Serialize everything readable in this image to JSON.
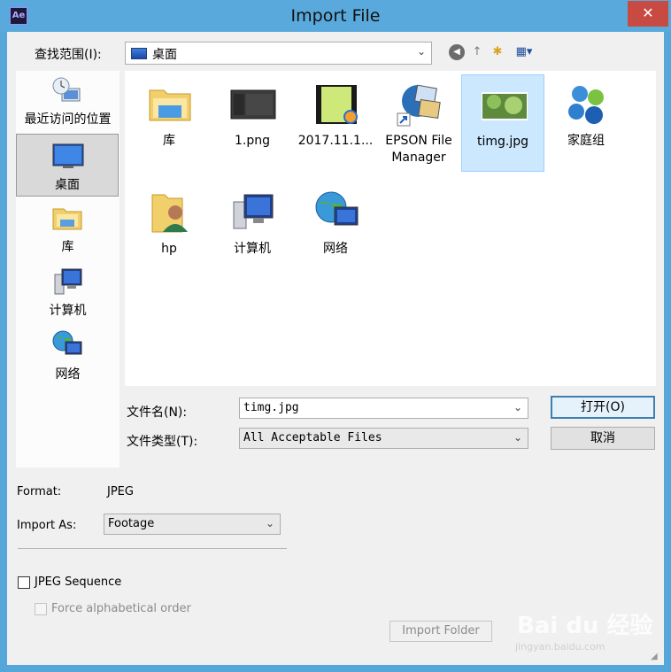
{
  "window": {
    "title": "Import File",
    "app_icon": "Ae",
    "close_glyph": "✕"
  },
  "toolbar": {
    "lookin_label": "查找范围(I):",
    "lookin_value": "桌面",
    "back_icon": "◀",
    "up_icon": "↑",
    "newfolder_icon": "✱",
    "views_icon": "▦▾"
  },
  "places": [
    {
      "label": "最近访问的位置",
      "icon": "recent-places-icon"
    },
    {
      "label": "桌面",
      "icon": "desktop-icon",
      "selected": true
    },
    {
      "label": "库",
      "icon": "library-icon"
    },
    {
      "label": "计算机",
      "icon": "computer-icon"
    },
    {
      "label": "网络",
      "icon": "network-icon"
    }
  ],
  "files": [
    {
      "label": "库",
      "icon": "library-folder-icon"
    },
    {
      "label": "1.png",
      "icon": "png-thumbnail-icon"
    },
    {
      "label": "2017.11.1...",
      "icon": "video-file-icon"
    },
    {
      "label": "EPSON File Manager",
      "icon": "epson-shortcut-icon"
    },
    {
      "label": "timg.jpg",
      "icon": "jpg-thumbnail-icon",
      "selected": true
    },
    {
      "label": "家庭组",
      "icon": "homegroup-icon"
    },
    {
      "label": "hp",
      "icon": "user-folder-icon"
    },
    {
      "label": "计算机",
      "icon": "computer-icon"
    },
    {
      "label": "网络",
      "icon": "network-icon"
    }
  ],
  "form": {
    "filename_label": "文件名(N):",
    "filename_value": "timg.jpg",
    "filetype_label": "文件类型(T):",
    "filetype_value": "All Acceptable Files",
    "open_label": "打开(O)",
    "cancel_label": "取消"
  },
  "options": {
    "format_label": "Format:",
    "format_value": "JPEG",
    "import_as_label": "Import As:",
    "import_as_value": "Footage",
    "sequence_label": "JPEG Sequence",
    "alpha_label": "Force alphabetical order",
    "import_folder_label": "Import Folder"
  },
  "watermark": {
    "text": "Bai du 经验",
    "url": "jingyan.baidu.com"
  }
}
